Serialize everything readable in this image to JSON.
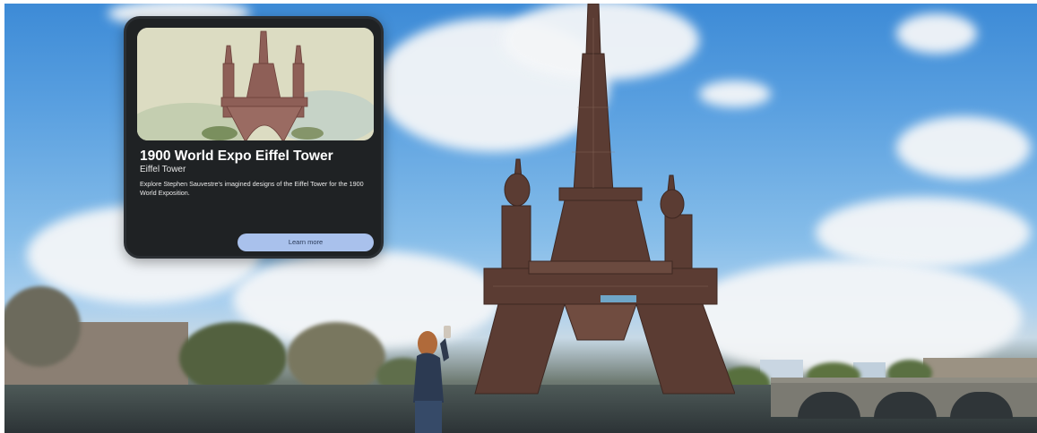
{
  "card": {
    "title": "1900 World Expo Eiffel Tower",
    "subtitle": "Eiffel Tower",
    "description": "Explore Stephen Sauvestre's imagined designs of the Eiffel Tower for the 1900 World Exposition.",
    "button_label": "Learn more"
  },
  "colors": {
    "card_background": "#1f2224",
    "button_background": "#a9c1ec",
    "sky": "#5aa0e0"
  }
}
